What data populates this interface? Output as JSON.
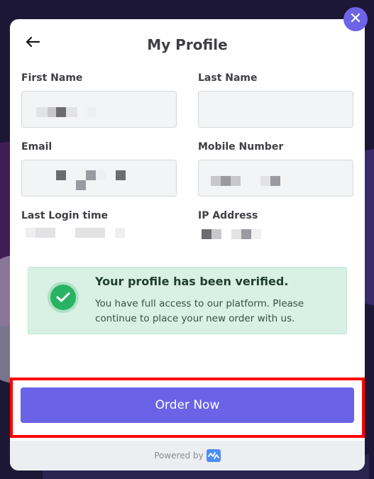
{
  "header": {
    "title": "My Profile",
    "back_icon": "arrow-left-icon",
    "close_icon": "close-icon"
  },
  "fields": {
    "first_name_label": "First Name",
    "last_name_label": "Last Name",
    "email_label": "Email",
    "mobile_label": "Mobile Number",
    "last_login_label": "Last Login time",
    "ip_label": "IP Address"
  },
  "verification": {
    "title": "Your profile has been verified.",
    "message": "You have full access to our platform. Please continue to place your new order with us.",
    "icon": "check-circle-icon"
  },
  "actions": {
    "order_label": "Order Now"
  },
  "footer": {
    "powered_label": "Powered by",
    "logo_icon": "brand-logo-icon"
  },
  "colors": {
    "accent": "#6a63e8",
    "success": "#27b363",
    "success_bg": "#d8f1e4",
    "highlight": "#ff0000"
  }
}
